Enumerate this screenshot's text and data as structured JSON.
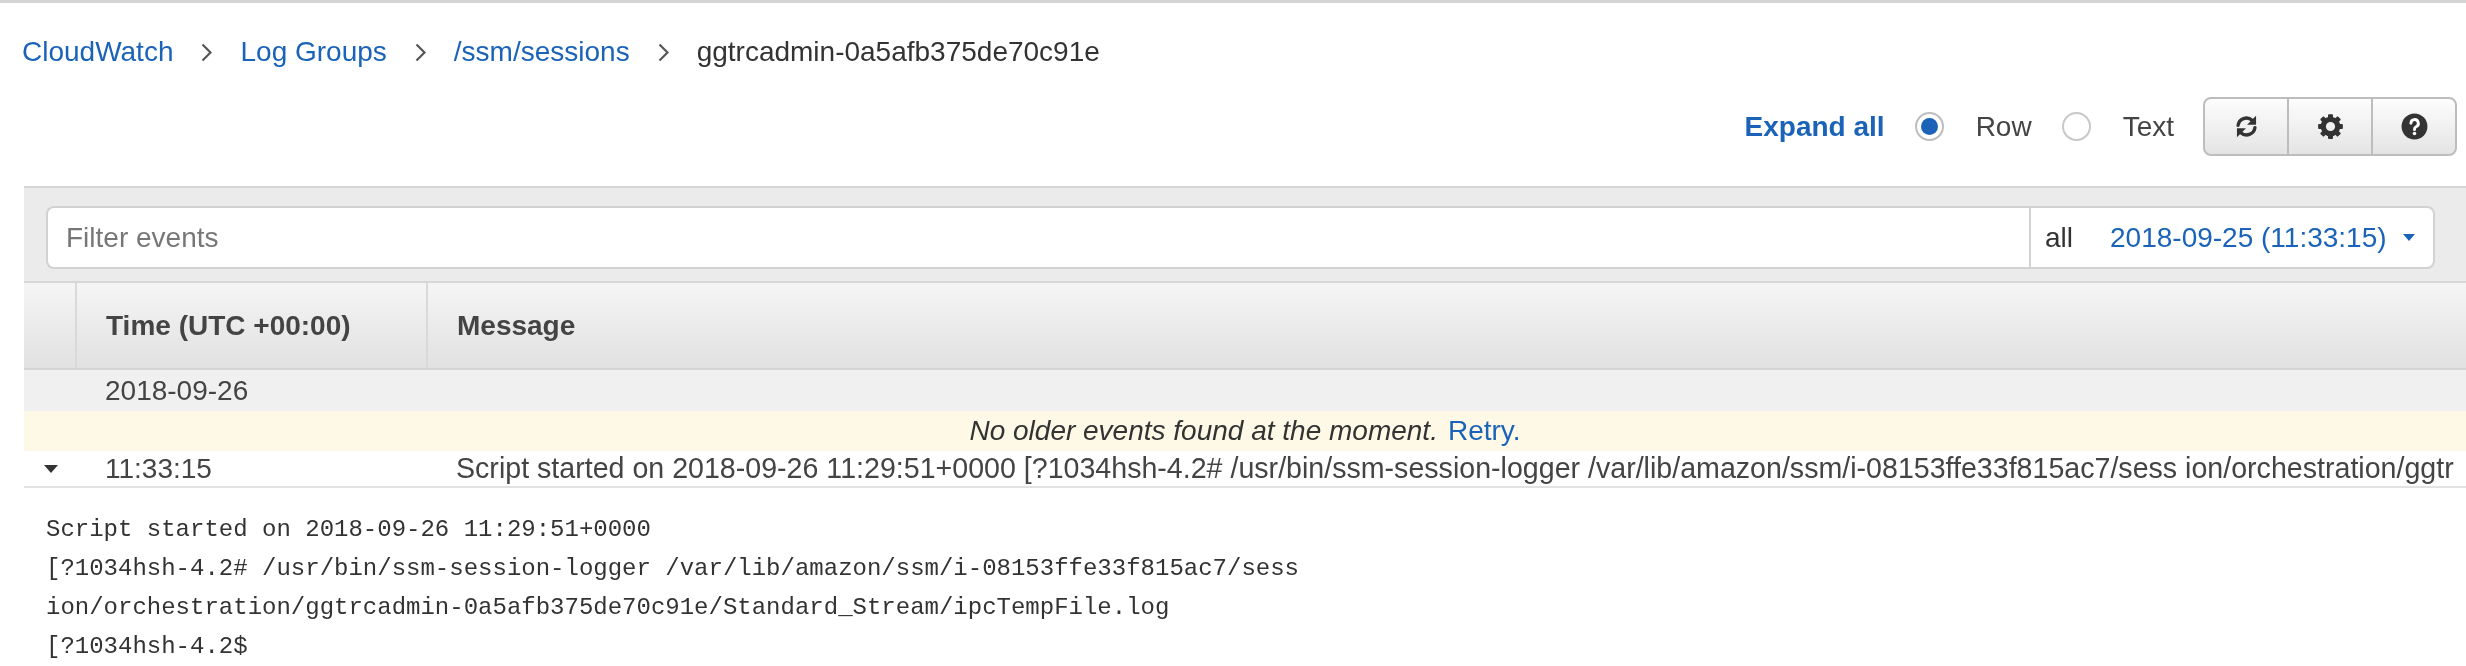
{
  "breadcrumb": [
    {
      "label": "CloudWatch",
      "current": false
    },
    {
      "label": "Log Groups",
      "current": false
    },
    {
      "label": "/ssm/sessions",
      "current": false
    },
    {
      "label": "ggtrcadmin-0a5afb375de70c91e",
      "current": true
    }
  ],
  "toolbar": {
    "expand_all": "Expand all",
    "view_options": [
      {
        "label": "Row",
        "selected": true
      },
      {
        "label": "Text",
        "selected": false
      }
    ],
    "buttons": [
      {
        "kind": "refresh"
      },
      {
        "kind": "settings"
      },
      {
        "kind": "help"
      }
    ]
  },
  "filter": {
    "placeholder": "Filter events",
    "scope": "all",
    "range": "2018-09-25 (11:33:15)"
  },
  "table": {
    "columns": [
      "Time (UTC +00:00)",
      "Message"
    ],
    "date_group": "2018-09-26",
    "notice": {
      "text": "No older events found at the moment.",
      "action": "Retry."
    },
    "rows": [
      {
        "time": "11:33:15",
        "message": "Script started on 2018-09-26 11:29:51+0000 [?1034hsh-4.2# /usr/bin/ssm-session-logger /var/lib/amazon/ssm/i-08153ffe33f815ac7/sess ion/orchestration/ggtr",
        "expanded": true,
        "detail": [
          "Script started on 2018-09-26 11:29:51+0000",
          "[?1034hsh-4.2# /usr/bin/ssm-session-logger /var/lib/amazon/ssm/i-08153ffe33f815ac7/sess",
          "ion/orchestration/ggtrcadmin-0a5afb375de70c91e/Standard_Stream/ipcTempFile.log",
          "[?1034hsh-4.2$"
        ]
      }
    ]
  }
}
